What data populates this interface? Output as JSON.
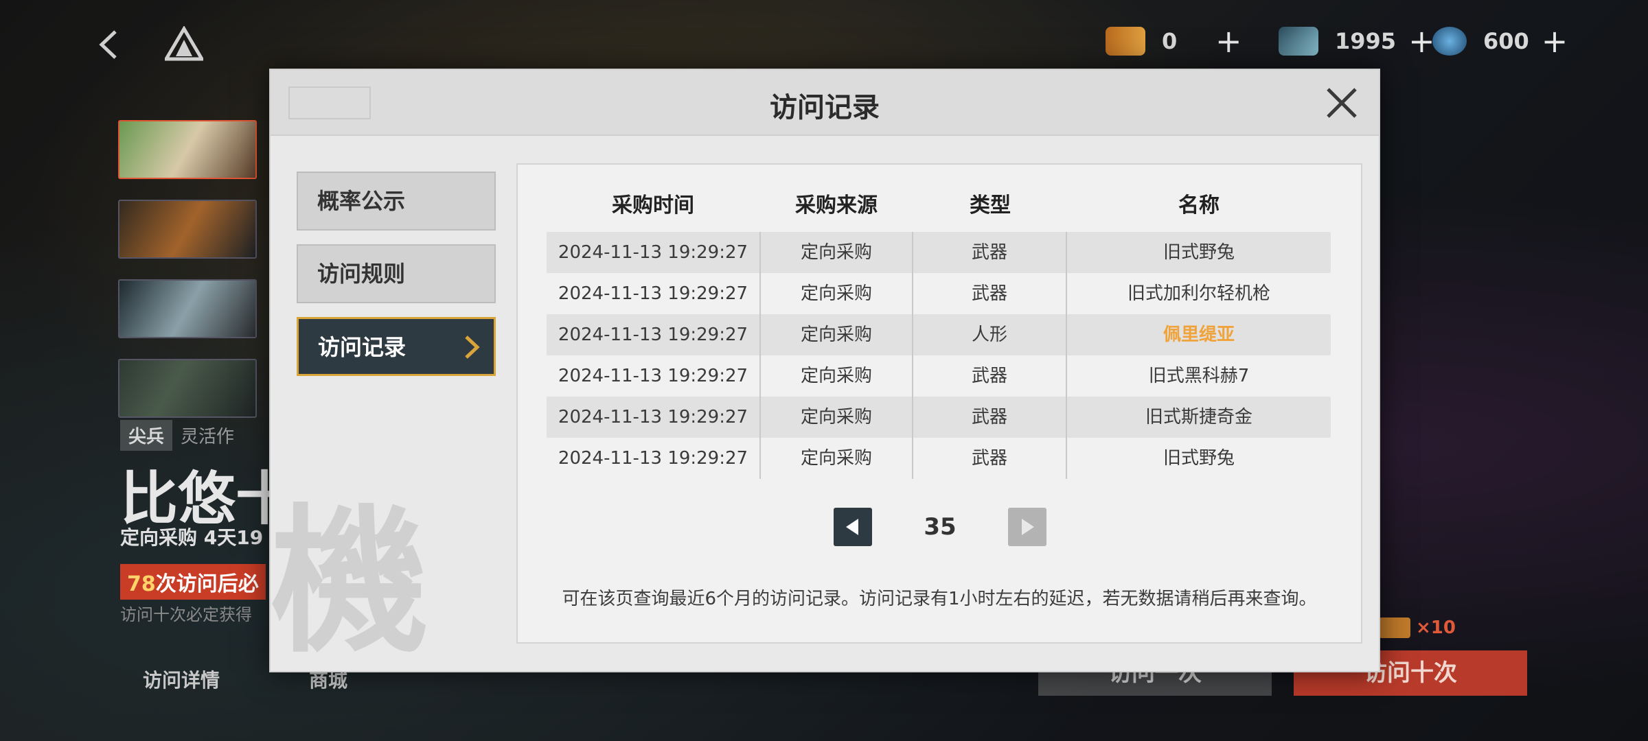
{
  "currency": {
    "tickets": {
      "value": "0",
      "icon": "ticket-icon"
    },
    "collapse": {
      "value": "1995",
      "icon": "crystal-icon"
    },
    "gems": {
      "value": "600",
      "icon": "gem-icon"
    }
  },
  "background": {
    "rank": "尖兵",
    "role_desc": "灵活作",
    "banner_title": "比悠十",
    "banner_sub": "定向采购  4天19",
    "pity_count": "78",
    "pity_text": "次访问后必",
    "guarantee_note": "访问十次必定获得",
    "link_details": "访问详情",
    "link_shop": "商城",
    "btn_once": "访问一次",
    "btn_ten": "访问十次",
    "ticket_multiplier": "×10"
  },
  "modal": {
    "title": "访问记录",
    "watermark": "機",
    "menu": [
      {
        "label": "概率公示"
      },
      {
        "label": "访问规则"
      },
      {
        "label": "访问记录"
      }
    ],
    "table": {
      "headers": [
        "采购时间",
        "采购来源",
        "类型",
        "名称"
      ],
      "rows": [
        {
          "time": "2024-11-13 19:29:27",
          "source": "定向采购",
          "type": "武器",
          "name": "旧式野兔"
        },
        {
          "time": "2024-11-13 19:29:27",
          "source": "定向采购",
          "type": "武器",
          "name": "旧式加利尔轻机枪"
        },
        {
          "time": "2024-11-13 19:29:27",
          "source": "定向采购",
          "type": "人形",
          "name": "佩里缇亚"
        },
        {
          "time": "2024-11-13 19:29:27",
          "source": "定向采购",
          "type": "武器",
          "name": "旧式黑科赫7"
        },
        {
          "time": "2024-11-13 19:29:27",
          "source": "定向采购",
          "type": "武器",
          "name": "旧式斯捷奇金"
        },
        {
          "time": "2024-11-13 19:29:27",
          "source": "定向采购",
          "type": "武器",
          "name": "旧式野兔"
        }
      ]
    },
    "page": "35",
    "note": "可在该页查询最近6个月的访问记录。访问记录有1小时左右的延迟，若无数据请稍后再来查询。"
  },
  "colors": {
    "accent_gold": "#d9a53b",
    "highlight_name": "#f0a33a",
    "dark_slate": "#2e3a42",
    "banner_red": "#c93c25"
  }
}
